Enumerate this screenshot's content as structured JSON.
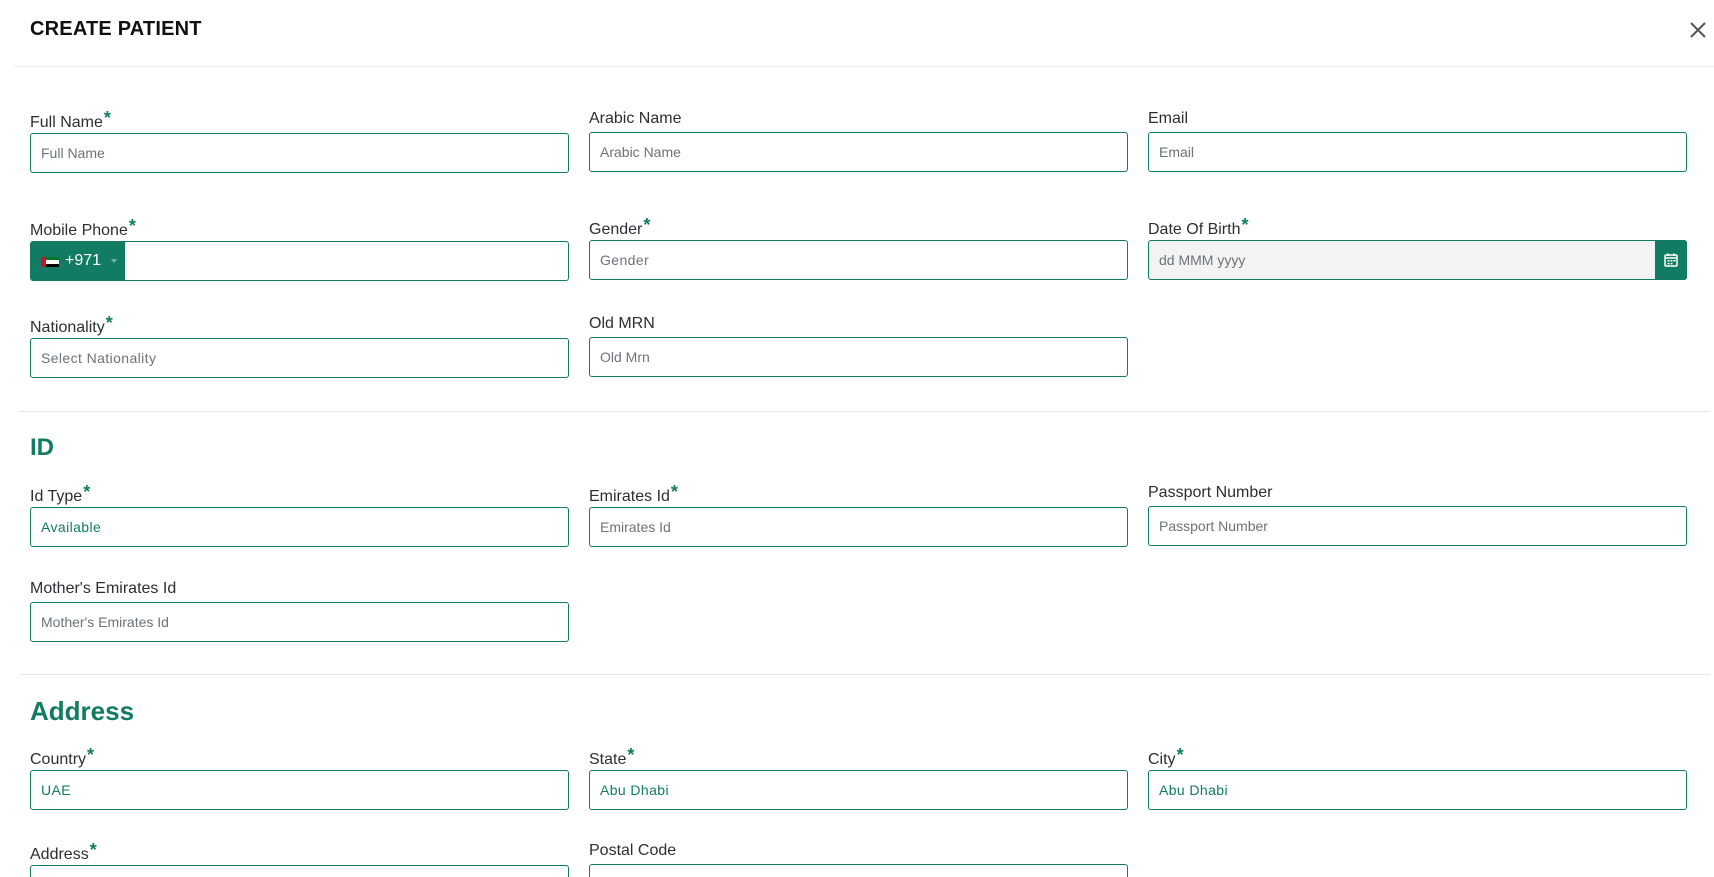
{
  "modal": {
    "title": "CREATE PATIENT"
  },
  "colors": {
    "accent": "#127b63",
    "border": "#127b63",
    "text": "#2b2f33"
  },
  "icons": {
    "close": "close-icon",
    "calendar": "calendar-icon",
    "flag": "uae-flag-icon"
  },
  "fields": {
    "full_name": {
      "label": "Full Name",
      "placeholder": "Full Name",
      "required": "*"
    },
    "arabic_name": {
      "label": "Arabic Name",
      "placeholder": "Arabic Name"
    },
    "email": {
      "label": "Email",
      "placeholder": "Email"
    },
    "mobile_phone": {
      "label": "Mobile Phone",
      "required": "*",
      "dial_code": "+971",
      "value": ""
    },
    "gender": {
      "label": "Gender",
      "placeholder": "Gender",
      "required": "*"
    },
    "dob": {
      "label": "Date Of Birth",
      "placeholder": "dd MMM yyyy",
      "required": "*"
    },
    "nationality": {
      "label": "Nationality",
      "placeholder": "Select Nationality",
      "required": "*"
    },
    "old_mrn": {
      "label": "Old MRN",
      "placeholder": "Old Mrn"
    }
  },
  "id_section": {
    "heading": "ID",
    "id_type": {
      "label": "Id Type",
      "value": "Available",
      "required": "*"
    },
    "emirates_id": {
      "label": "Emirates Id",
      "placeholder": "Emirates Id",
      "required": "*"
    },
    "passport": {
      "label": "Passport Number",
      "placeholder": "Passport Number"
    },
    "mother_emirates_id": {
      "label": "Mother's Emirates Id",
      "placeholder": "Mother's Emirates Id"
    }
  },
  "address_section": {
    "heading": "Address",
    "country": {
      "label": "Country",
      "value": "UAE",
      "required": "*"
    },
    "state": {
      "label": "State",
      "value": "Abu Dhabi",
      "required": "*"
    },
    "city": {
      "label": "City",
      "value": "Abu Dhabi",
      "required": "*"
    },
    "address": {
      "label": "Address",
      "required": "*"
    },
    "postal_code": {
      "label": "Postal Code"
    }
  }
}
